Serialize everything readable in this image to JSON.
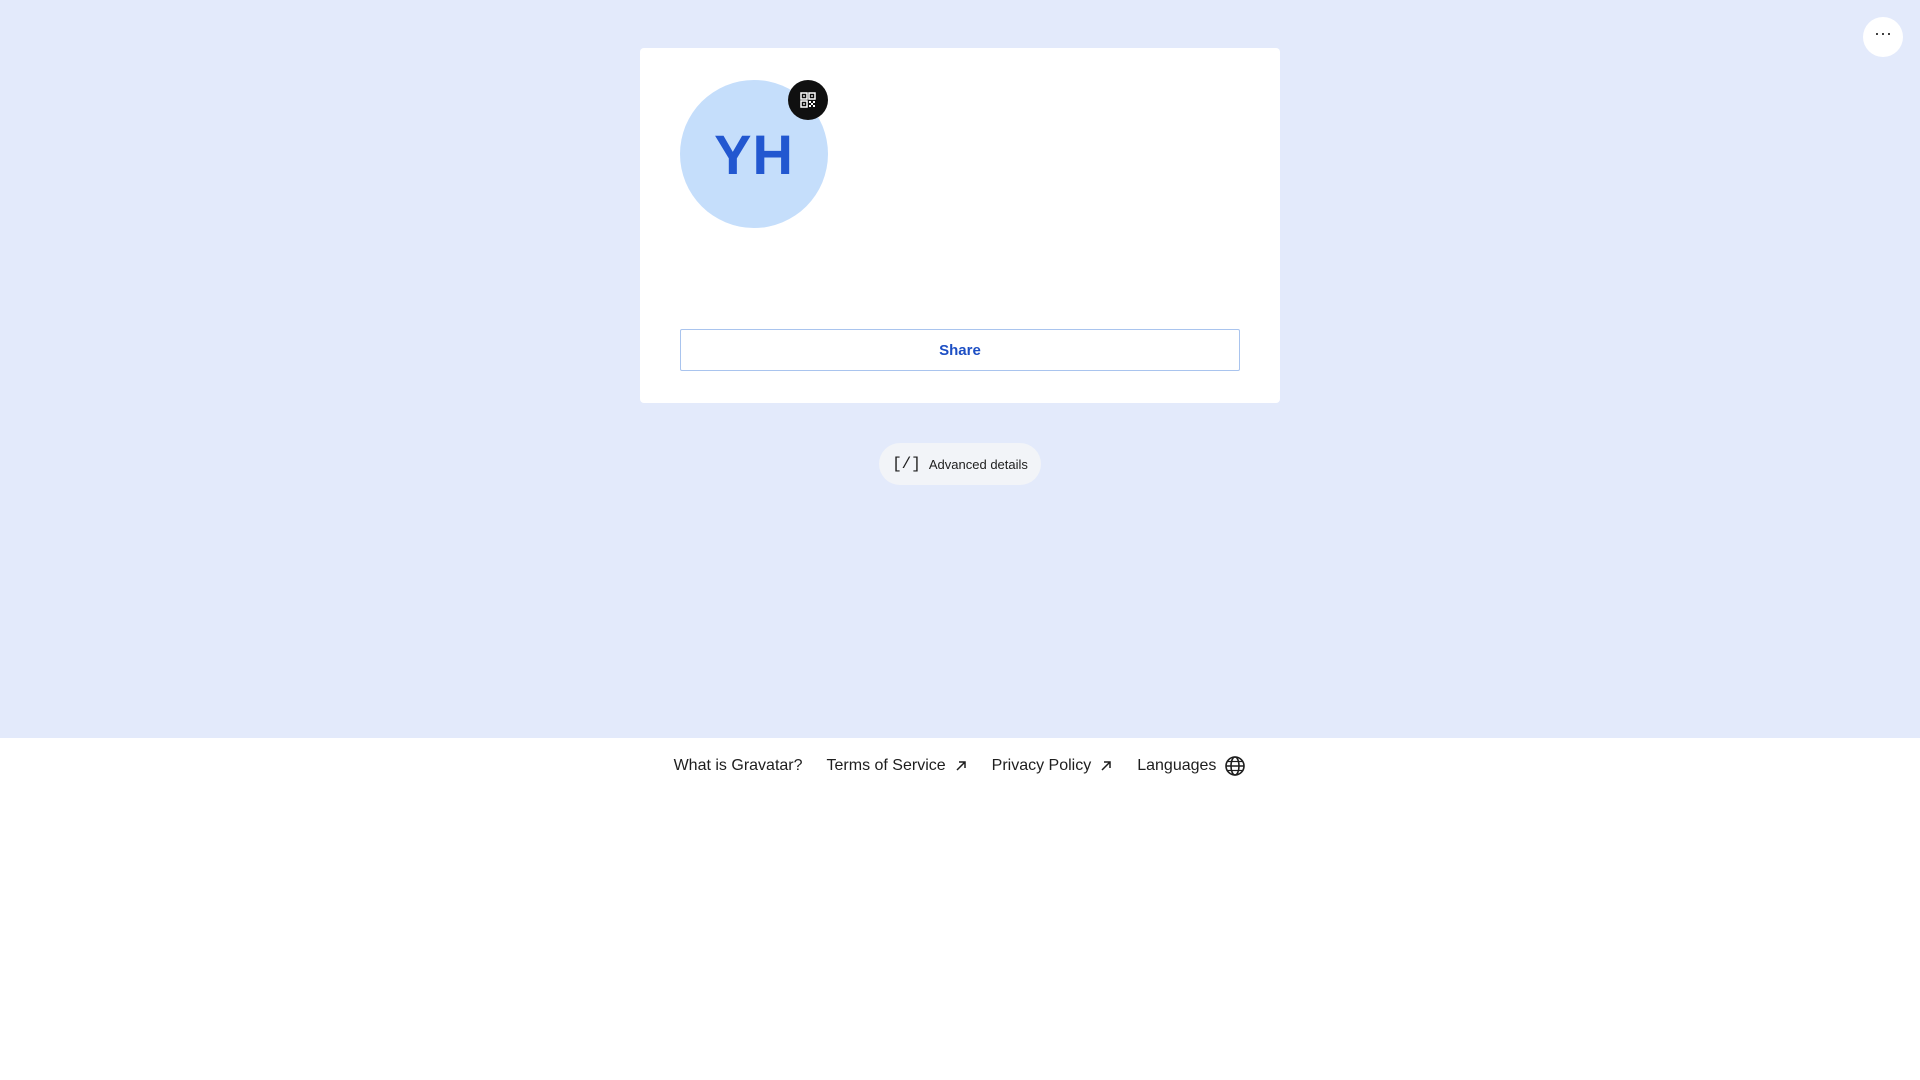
{
  "top_actions": {
    "more_label": "···",
    "more_icon": "more-horizontal-icon"
  },
  "profile": {
    "initials": "YH",
    "qr_icon": "qr-code-icon",
    "share_label": "Share"
  },
  "advanced": {
    "icon_text": "[/]",
    "label": "Advanced details"
  },
  "footer": {
    "links": [
      {
        "label": "What is Gravatar?",
        "icon": ""
      },
      {
        "label": "Terms of Service",
        "icon": "external-arrow-icon"
      },
      {
        "label": "Privacy Policy",
        "icon": "external-arrow-icon"
      },
      {
        "label": "Languages",
        "icon": "globe-icon"
      }
    ]
  },
  "colors": {
    "hero_background": "#e3eafb",
    "avatar_background": "#c5defb",
    "accent_blue": "#2257d0"
  }
}
